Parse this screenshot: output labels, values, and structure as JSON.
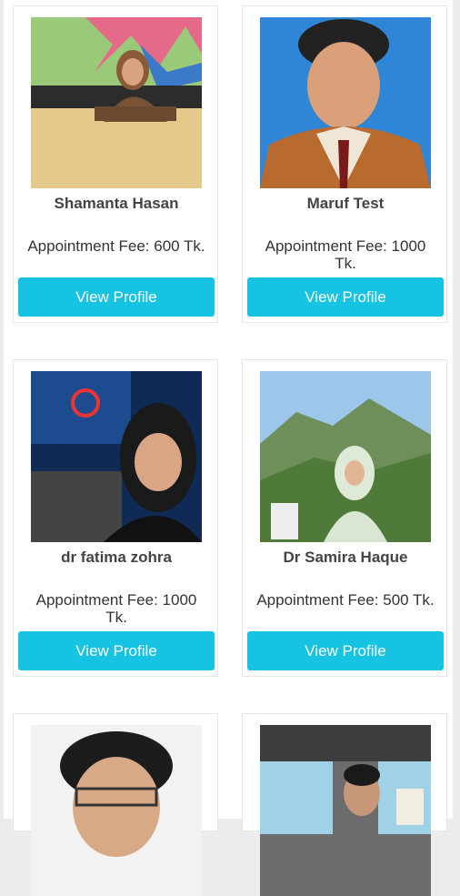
{
  "doctors": [
    {
      "name": "Shamanta Hasan",
      "fee_label": "Appointment Fee: 600 Tk.",
      "button": "View Profile",
      "photo": "portrait-woman-hijab-desk"
    },
    {
      "name": "Maruf Test",
      "fee_label": "Appointment Fee: 1000 Tk.",
      "button": "View Profile",
      "photo": "portrait-man-suit"
    },
    {
      "name": "dr fatima zohra",
      "fee_label": "Appointment Fee: 1000 Tk.",
      "button": "View Profile",
      "photo": "portrait-woman-studio"
    },
    {
      "name": "Dr Samira Haque",
      "fee_label": "Appointment Fee: 500 Tk.",
      "button": "View Profile",
      "photo": "portrait-woman-hills"
    }
  ],
  "partial_cards": [
    {
      "photo": "portrait-man-curly-hair"
    },
    {
      "photo": "portrait-man-in-car"
    }
  ],
  "colors": {
    "button": "#17c3e3",
    "background": "#ececec"
  }
}
